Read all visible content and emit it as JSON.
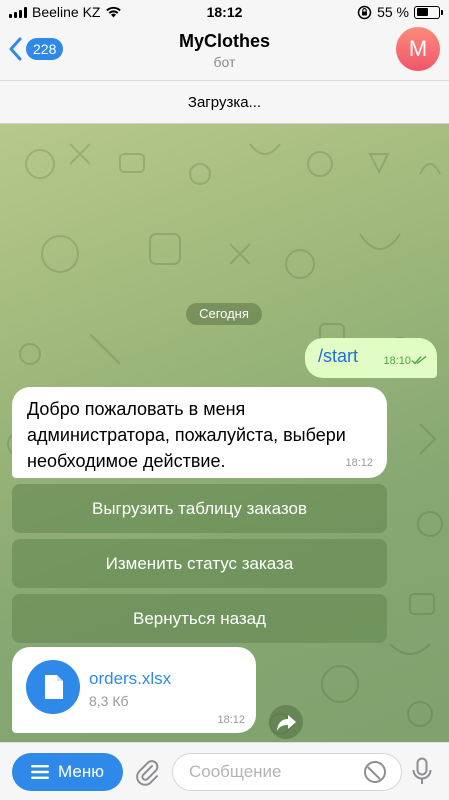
{
  "status_bar": {
    "carrier": "Beeline KZ",
    "time": "18:12",
    "battery": "55 %",
    "battery_level": 0.55
  },
  "header": {
    "back_count": "228",
    "title": "MyClothes",
    "subtitle": "бот",
    "avatar_letter": "M",
    "loading_text": "Загрузка..."
  },
  "chat": {
    "date_label": "Сегодня",
    "outgoing": {
      "text": "/start",
      "time": "18:10"
    },
    "incoming": {
      "text": "Добро пожаловать в меня администратора, пожалуйста, выбери необходимое действие.",
      "time": "18:12"
    },
    "keyboard": [
      {
        "label": "Выгрузить таблицу заказов"
      },
      {
        "label": "Изменить статус заказа"
      },
      {
        "label": "Вернуться назад"
      }
    ],
    "file": {
      "name": "orders.xlsx",
      "size": "8,3 Кб",
      "time": "18:12"
    }
  },
  "input_bar": {
    "menu_label": "Меню",
    "placeholder": "Сообщение"
  },
  "colors": {
    "accent": "#2f89e8",
    "outgoing_bubble": "#e2fcc6",
    "chat_bg": "#9db77a"
  },
  "icons": [
    "signal-icon",
    "wifi-icon",
    "orientation-lock-icon",
    "battery-icon",
    "chevron-left-icon",
    "file-icon",
    "share-icon",
    "menu-icon",
    "paperclip-icon",
    "sticker-icon",
    "microphone-icon",
    "read-ticks-icon"
  ]
}
